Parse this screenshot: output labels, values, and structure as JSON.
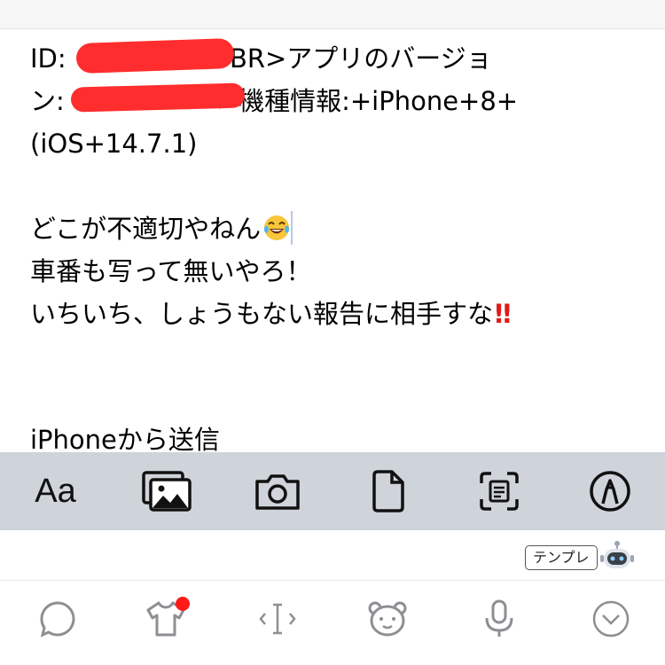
{
  "message": {
    "line1": "ID:",
    "line1_tail": "<BR>アプリのバージョ",
    "line2": "ン:",
    "line2_tail": ">機種情報:+iPhone+8+",
    "line3": "(iOS+14.7.1)",
    "line4": "どこが不適切やねん",
    "line5": "車番も写って無いやろ！",
    "line6": "いちいち、しょうもない報告に相手すな",
    "bangs": "!!",
    "signature": "iPhoneから送信"
  },
  "format_toolbar": {
    "text_style_label": "Aa",
    "icons": [
      "text-style",
      "photo-library-icon",
      "camera-icon",
      "document-icon",
      "scan-text-icon",
      "markup-icon"
    ]
  },
  "template": {
    "label": "テンプレ"
  },
  "bottom_bar": {
    "icons": [
      "chat-bubble-icon",
      "shirt-icon",
      "cursor-icon",
      "bear-face-icon",
      "microphone-icon",
      "chevron-down-circle-icon"
    ],
    "badge_color": "#ff1a1a"
  },
  "colors": {
    "toolbar_bg": "#cfd3da",
    "redaction": "#ff2d2d",
    "alert_red": "#e01a1a"
  }
}
